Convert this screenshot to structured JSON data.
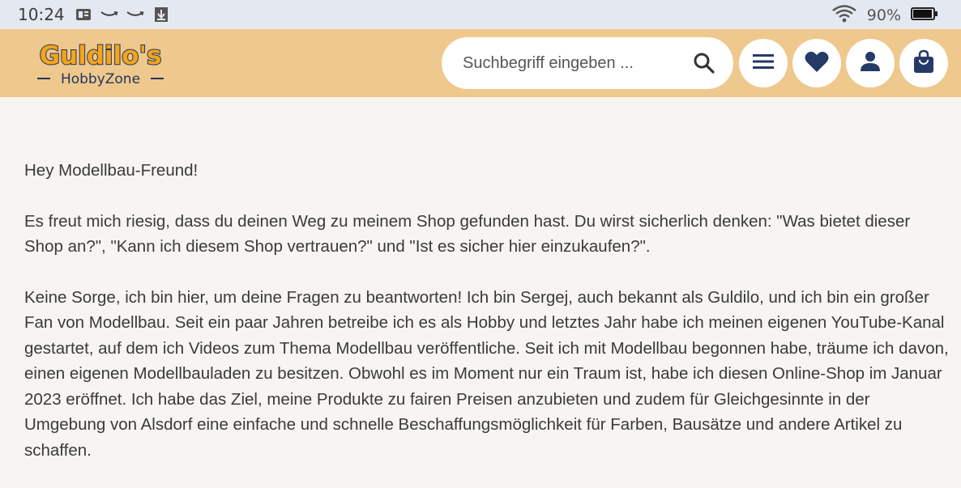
{
  "status_bar": {
    "time": "10:24",
    "battery_percent": "90%",
    "notification_icons": [
      "news-icon",
      "amazon-icon",
      "amazon-icon",
      "download-icon"
    ]
  },
  "header": {
    "logo": {
      "name": "Guldilo's",
      "subtitle": "HobbyZone"
    },
    "search": {
      "placeholder": "Suchbegriff eingeben ..."
    },
    "buttons": [
      "menu-icon",
      "heart-icon",
      "user-icon",
      "shopping-bag-icon"
    ],
    "colors": {
      "bar": "#efc88d",
      "icon": "#253a66",
      "logo_fill": "#f3a51c"
    }
  },
  "content": {
    "greeting": "Hey Modellbau-Freund!",
    "paragraph_1": "Es freut mich riesig, dass du deinen Weg zu meinem Shop gefunden hast. Du wirst sicherlich denken: \"Was bietet dieser Shop an?\", \"Kann ich diesem Shop vertrauen?\" und \"Ist es sicher hier einzukaufen?\".",
    "paragraph_2": "Keine Sorge, ich bin hier, um deine Fragen zu beantworten! Ich bin Sergej, auch bekannt als Guldilo, und ich bin ein großer Fan von Modellbau. Seit ein paar Jahren betreibe ich es als Hobby und letztes Jahr habe ich meinen eigenen YouTube-Kanal gestartet, auf dem ich Videos zum Thema Modellbau veröffentliche. Seit ich mit Modellbau begonnen habe, träume ich davon, einen eigenen Modellbauladen zu besitzen. Obwohl es im Moment nur ein Traum ist, habe ich diesen Online-Shop im Januar 2023 eröffnet. Ich habe das Ziel, meine Produkte zu fairen Preisen anzubieten und zudem für Gleichgesinnte in der Umgebung von Alsdorf eine einfache und schnelle Beschaffungsmöglichkeit für Farben, Bausätze und andere Artikel zu schaffen."
  }
}
